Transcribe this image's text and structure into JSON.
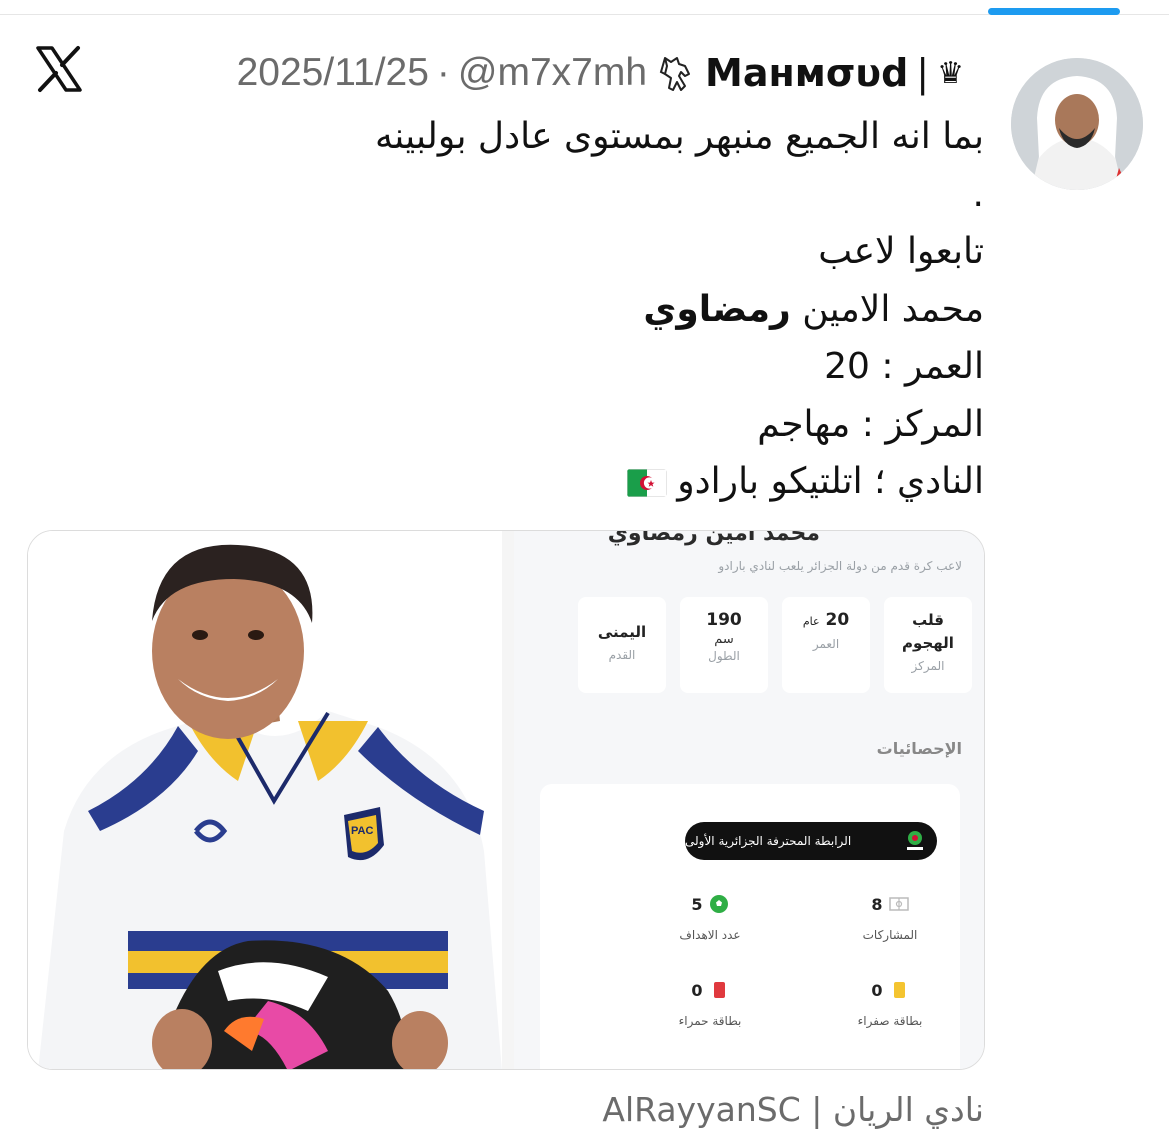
{
  "tweet": {
    "date": "2025/11/25",
    "separator": "·",
    "handle": "@m7x7mh",
    "display_name": "Maнмσυd",
    "pipe": "|",
    "crown": "♛",
    "lines": [
      "بما انه الجميع منبهر بمستوى عادل بولبينه",
      ".",
      "تابعوا لاعب",
      "العمر : 20",
      "المركز : مهاجم",
      "النادي ؛ اتلتيكو بارادو"
    ],
    "player_line": {
      "regular": "محمد الامين",
      "bold": "رمضاوي"
    },
    "flag_icon": "algeria-flag-icon"
  },
  "card": {
    "name": "محمد امين رمضاوي",
    "subtitle": "لاعب كرة قدم من دولة الجزائر يلعب لنادي بارادو",
    "info": [
      {
        "value": "قلب الهجوم",
        "label": "المركز"
      },
      {
        "value": "20",
        "unit": "عام",
        "label": "العمر"
      },
      {
        "value": "190",
        "unit": "سم",
        "label": "الطول"
      },
      {
        "value": "اليمنى",
        "label": "القدم"
      }
    ],
    "stats_title": "الإحصائيات",
    "league": "الرابطة المحترفة الجزائرية الأولى",
    "stats": [
      {
        "value": "8",
        "label": "المشاركات",
        "icon": "pitch-icon"
      },
      {
        "value": "5",
        "label": "عدد الاهداف",
        "icon": "football-icon"
      },
      {
        "value": "0",
        "label": "بطاقة صفراء",
        "icon": "yellow-card-icon"
      },
      {
        "value": "0",
        "label": "بطاقة حمراء",
        "icon": "red-card-icon"
      }
    ]
  },
  "source": "نادي الريان | AlRayyanSC",
  "colors": {
    "accent": "#1d9bf0",
    "muted": "#6b6b6b",
    "yellow_card": "#f4c430",
    "red_card": "#e0393e",
    "goal_green": "#2fae45"
  }
}
